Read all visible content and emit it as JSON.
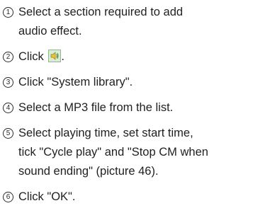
{
  "steps": [
    {
      "num": "1",
      "lines": [
        "Select a section required to add",
        "audio effect."
      ]
    },
    {
      "num": "2",
      "text": "Click",
      "icon": "speaker-icon",
      "suffix": "."
    },
    {
      "num": "3",
      "lines": [
        "Click \"System library\"."
      ]
    },
    {
      "num": "4",
      "lines": [
        "Select a MP3 file from the list."
      ]
    },
    {
      "num": "5",
      "lines": [
        "Select playing time, set start time,",
        "tick \"Cycle play\" and \"Stop CM when",
        "sound ending\" (picture 46)."
      ]
    },
    {
      "num": "6",
      "lines": [
        "Click \"OK\"."
      ]
    }
  ]
}
